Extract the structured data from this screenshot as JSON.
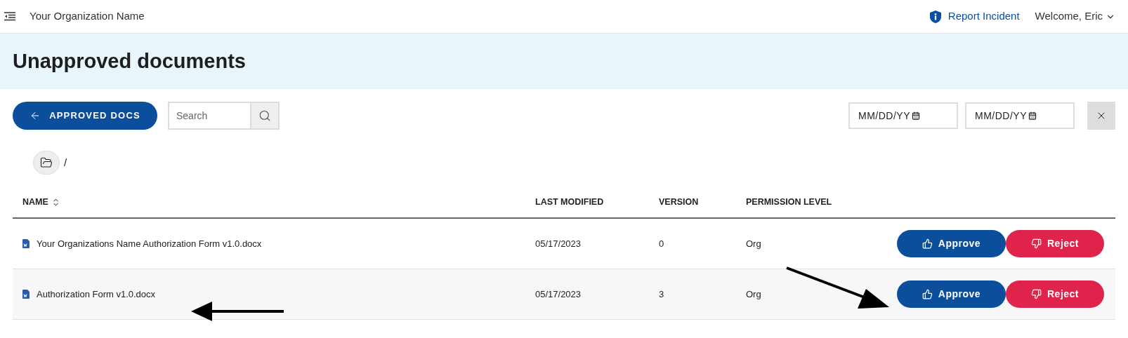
{
  "header": {
    "org_name": "Your Organization Name",
    "report_link": "Report Incident",
    "user_menu": "Welcome, Eric"
  },
  "page_title": "Unapproved documents",
  "toolbar": {
    "back_button": "APPROVED DOCS",
    "search": {
      "placeholder": "Search"
    },
    "date_from": {
      "placeholder": "MM/DD/YY"
    },
    "date_to": {
      "placeholder": "MM/DD/YY"
    }
  },
  "breadcrumb": {
    "separator": "/"
  },
  "table": {
    "columns": [
      {
        "label": "NAME",
        "sortable": true
      },
      {
        "label": "LAST MODIFIED",
        "sortable": false
      },
      {
        "label": "VERSION",
        "sortable": false
      },
      {
        "label": "PERMISSION LEVEL",
        "sortable": false
      }
    ],
    "rows": [
      {
        "name": "Your Organizations Name Authorization Form v1.0.docx",
        "last_modified": "05/17/2023",
        "version": "0",
        "permission": "Org",
        "approve": "Approve",
        "reject": "Reject"
      },
      {
        "name": "Authorization Form v1.0.docx",
        "last_modified": "05/17/2023",
        "version": "3",
        "permission": "Org",
        "approve": "Approve",
        "reject": "Reject"
      }
    ]
  }
}
